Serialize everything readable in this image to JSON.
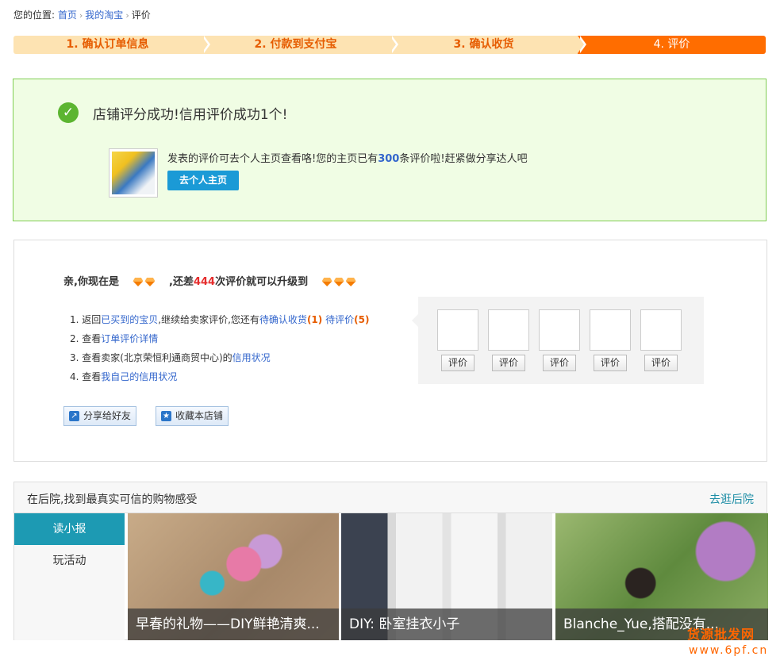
{
  "breadcrumb": {
    "prefix": "您的位置:",
    "items": [
      "首页",
      "我的淘宝"
    ],
    "current": "评价"
  },
  "steps": [
    {
      "label": "1. 确认订单信息",
      "active": false
    },
    {
      "label": "2. 付款到支付宝",
      "active": false
    },
    {
      "label": "3. 确认收货",
      "active": false
    },
    {
      "label": "4. 评价",
      "active": true
    }
  ],
  "success": {
    "message": "店铺评分成功!信用评价成功1个!",
    "desc_prefix": "发表的评价可去个人主页查看咯!您的主页已有",
    "review_count": "300",
    "desc_suffix": "条评价啦!赶紧做分享达人吧",
    "home_button": "去个人主页"
  },
  "level": {
    "title_prefix": "亲,你现在是",
    "title_mid": ",还差",
    "remaining": "444",
    "title_suffix": "次评价就可以升级到",
    "list": {
      "item1_prefix": "1. 返回",
      "item1_link": "已买到的宝贝",
      "item1_mid": ",继续给卖家评价,您还有",
      "item1_pending_confirm": "待确认收货",
      "item1_pending_confirm_count": "(1)",
      "item1_pending_rate": "待评价",
      "item1_pending_rate_count": "(5)",
      "item2_prefix": "2. 查看",
      "item2_link": "订单评价详情",
      "item3_prefix": "3. 查看卖家(北京荣恒利通商贸中心)的",
      "item3_link": "信用状况",
      "item4_prefix": "4. 查看",
      "item4_link": "我自己的信用状况"
    },
    "share_button": "分享给好友",
    "favorite_button": "收藏本店铺",
    "rate_button_label": "评价"
  },
  "backyard": {
    "title": "在后院,找到最真实可信的购物感受",
    "more": "去逛后院",
    "tabs": [
      {
        "label": "读小报",
        "active": true
      },
      {
        "label": "玩活动",
        "active": false
      }
    ],
    "cards": [
      {
        "caption": "早春的礼物——DIY鲜艳清爽..."
      },
      {
        "caption": "DIY: 卧室挂衣小子"
      },
      {
        "caption": "Blanche_Yue,搭配没有..."
      }
    ]
  },
  "watermark": {
    "line1": "货源批发网",
    "line2": "www.6pf.cn"
  },
  "colors": {
    "step_active": "#ff6d00",
    "step_inactive": "#fde3b2",
    "success_bg": "#f0fde4",
    "link": "#3366cc",
    "accent_blue": "#1b9ad6",
    "tab_active": "#1d9ab3"
  }
}
